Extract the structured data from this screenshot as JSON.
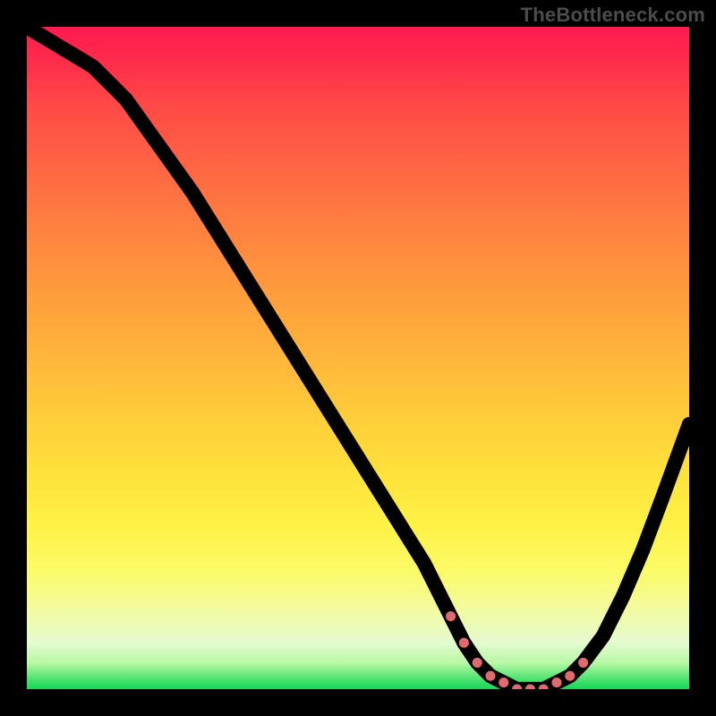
{
  "watermark": "TheBottleneck.com",
  "chart_data": {
    "type": "line",
    "title": "",
    "xlabel": "",
    "ylabel": "",
    "xlim": [
      0,
      100
    ],
    "ylim": [
      0,
      100
    ],
    "series": [
      {
        "name": "bottleneck-curve",
        "x": [
          0,
          5,
          10,
          15,
          20,
          25,
          30,
          35,
          40,
          45,
          50,
          55,
          60,
          64,
          66,
          68,
          70,
          72,
          74,
          76,
          78,
          80,
          82,
          84,
          87,
          90,
          93,
          96,
          100
        ],
        "values": [
          100,
          97,
          94,
          89,
          82,
          75,
          67,
          59,
          51,
          43,
          35,
          27,
          19,
          11,
          7,
          4,
          2,
          1,
          0,
          0,
          0,
          1,
          2,
          4,
          8,
          14,
          21,
          29,
          40
        ]
      }
    ],
    "highlight_points": {
      "name": "optimal-range-dots",
      "color": "#e06a6d",
      "x": [
        64,
        66,
        68,
        70,
        72,
        74,
        76,
        78,
        80,
        82,
        84
      ],
      "values": [
        11,
        7,
        4,
        2,
        1,
        0,
        0,
        0,
        1,
        2,
        4
      ]
    },
    "gradient_scale": [
      "#ff1a4f",
      "#ffbb3b",
      "#fbfb66",
      "#15d85a"
    ]
  }
}
